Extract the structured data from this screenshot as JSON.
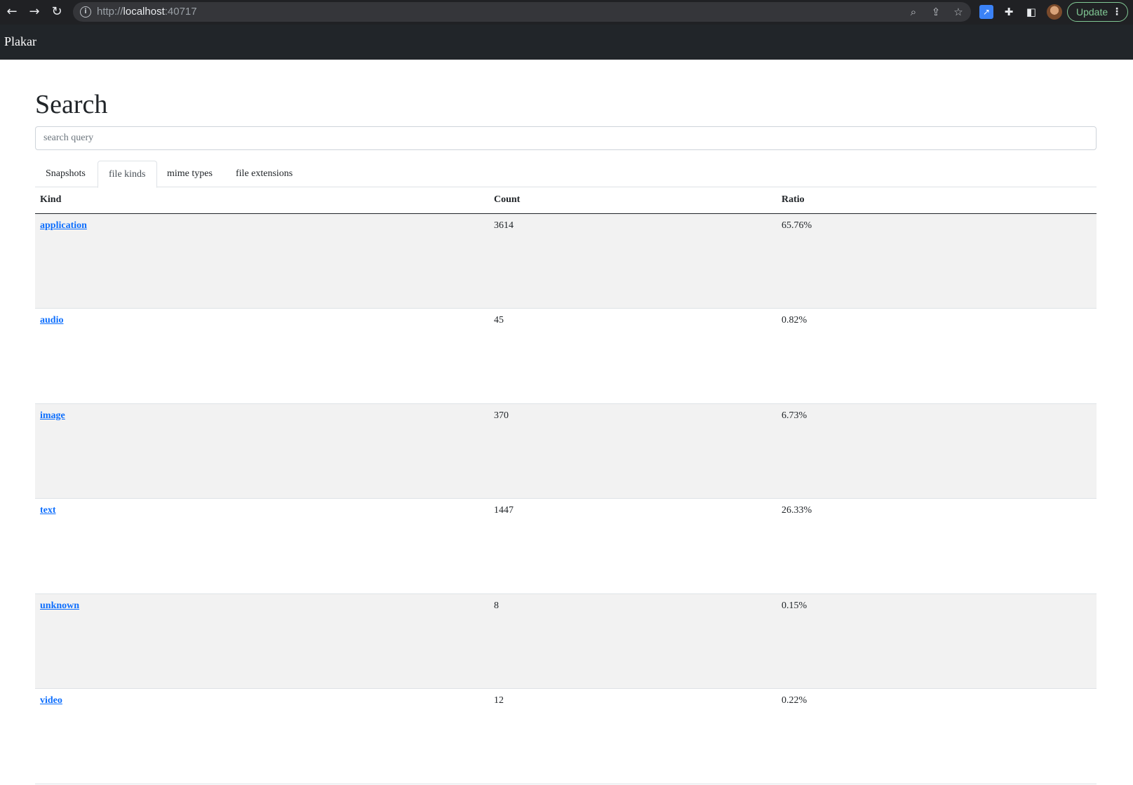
{
  "browser": {
    "url_scheme": "http://",
    "url_host": "localhost",
    "url_port": ":40717",
    "update_label": "Update"
  },
  "navbar": {
    "brand": "Plakar"
  },
  "page": {
    "title": "Search",
    "search_placeholder": "search query",
    "search_value": ""
  },
  "tabs": [
    {
      "label": "Snapshots",
      "active": false
    },
    {
      "label": "file kinds",
      "active": true
    },
    {
      "label": "mime types",
      "active": false
    },
    {
      "label": "file extensions",
      "active": false
    }
  ],
  "table": {
    "headers": {
      "kind": "Kind",
      "count": "Count",
      "ratio": "Ratio"
    },
    "rows": [
      {
        "kind": "application",
        "count": "3614",
        "ratio": "65.76%"
      },
      {
        "kind": "audio",
        "count": "45",
        "ratio": "0.82%"
      },
      {
        "kind": "image",
        "count": "370",
        "ratio": "6.73%"
      },
      {
        "kind": "text",
        "count": "1447",
        "ratio": "26.33%"
      },
      {
        "kind": "unknown",
        "count": "8",
        "ratio": "0.15%"
      },
      {
        "kind": "video",
        "count": "12",
        "ratio": "0.22%"
      }
    ]
  }
}
